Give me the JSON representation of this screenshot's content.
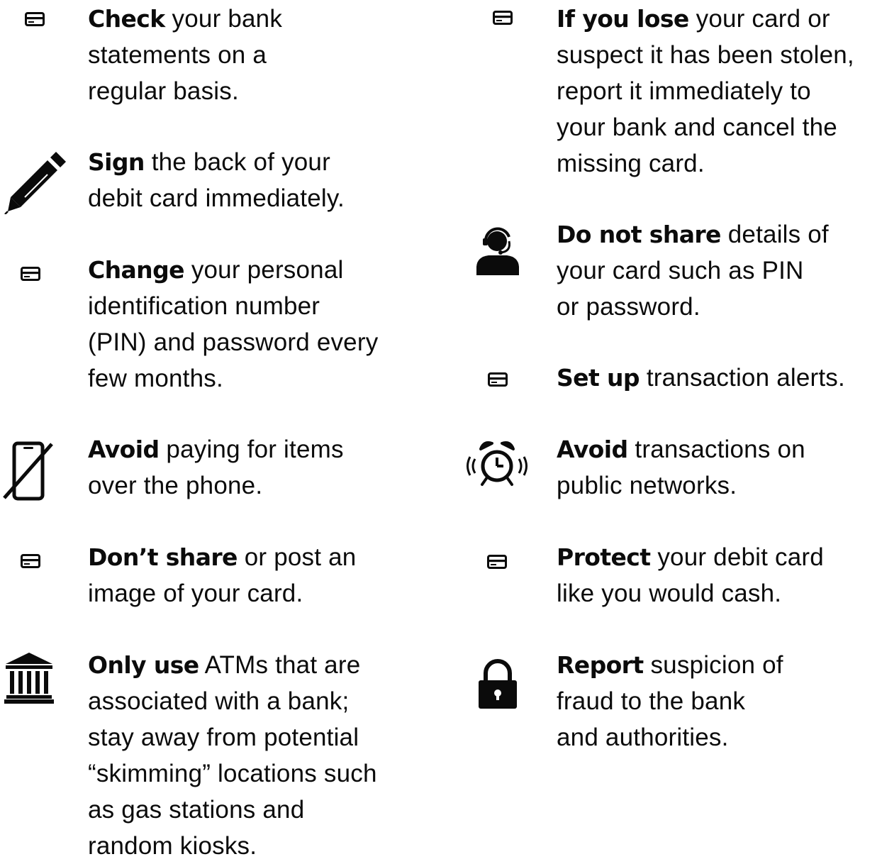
{
  "left_column": [
    {
      "icon": "credit-card-icon",
      "bold": "Check",
      "lines": [
        " your bank",
        "statements on a",
        "regular basis."
      ]
    },
    {
      "icon": "pen-icon",
      "bold": "Sign",
      "lines": [
        " the back of your",
        "debit card immediately."
      ]
    },
    {
      "icon": "credit-card-icon",
      "bold": "Change",
      "lines": [
        " your personal",
        "identification number",
        "(PIN) and password every",
        "few months."
      ]
    },
    {
      "icon": "no-phone-icon",
      "bold": "Avoid",
      "lines": [
        " paying for items",
        "over the phone."
      ]
    },
    {
      "icon": "credit-card-icon",
      "bold": "Don’t share",
      "lines": [
        " or post an",
        "image of your card."
      ]
    },
    {
      "icon": "bank-icon",
      "bold": "Only use",
      "lines": [
        " ATMs that are",
        "associated with a bank;",
        "stay away from potential",
        "“skimming” locations such",
        "as gas stations and",
        "random kiosks."
      ]
    }
  ],
  "right_column": [
    {
      "icon": "credit-card-icon",
      "bold": "If you lose",
      "lines": [
        " your card or",
        "suspect it has been stolen,",
        "report it immediately to",
        "your bank and cancel the",
        "missing card."
      ]
    },
    {
      "icon": "support-agent-icon",
      "bold": "Do not share",
      "lines": [
        " details of",
        "your card such as PIN",
        "or password."
      ]
    },
    {
      "icon": "credit-card-icon",
      "bold": "Set up",
      "lines": [
        " transaction alerts."
      ]
    },
    {
      "icon": "alarm-clock-icon",
      "bold": "Avoid",
      "lines": [
        " transactions on",
        "public networks."
      ]
    },
    {
      "icon": "credit-card-icon",
      "bold": "Protect",
      "lines": [
        " your debit card",
        "like you would cash."
      ]
    },
    {
      "icon": "lock-icon",
      "bold": "Report",
      "lines": [
        " suspicion of",
        "fraud to the bank",
        "and authorities."
      ]
    }
  ]
}
